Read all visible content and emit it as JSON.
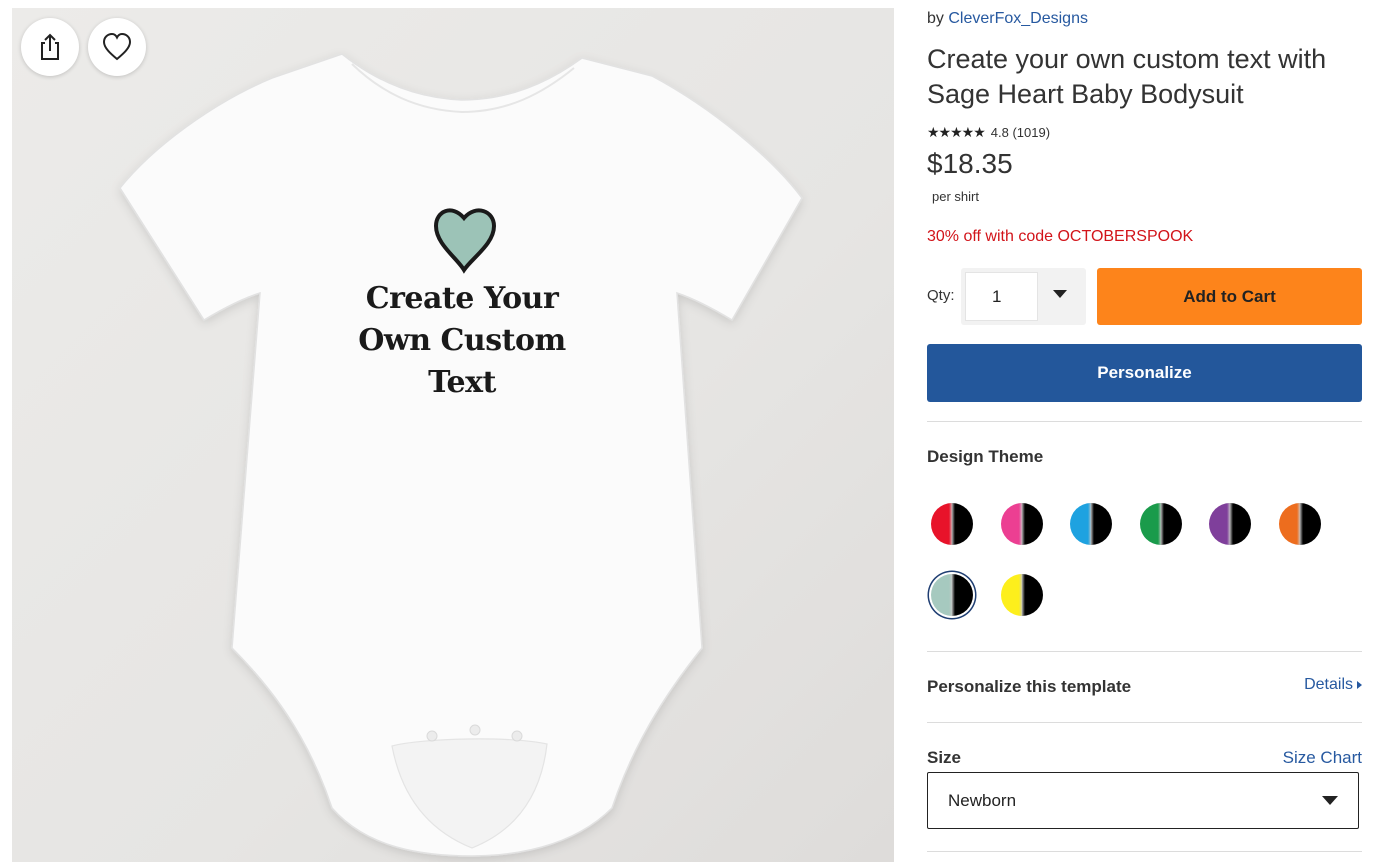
{
  "image": {
    "print_lines": [
      "Create Your",
      "Own Custom",
      "Text"
    ],
    "heart_color": "#9cc3b7",
    "share_icon": "share-icon",
    "favorite_icon": "heart-outline-icon"
  },
  "product": {
    "by_prefix": "by",
    "designer": "CleverFox_Designs",
    "title": "Create your own custom text with Sage Heart Baby Bodysuit",
    "stars": "★★★★★",
    "rating": "4.8",
    "review_count": "(1019)",
    "price": "$18.35",
    "price_unit": "per shirt",
    "promo": "30% off with code OCTOBERSPOOK"
  },
  "purchase": {
    "qty_label": "Qty:",
    "qty_value": "1",
    "add_to_cart": "Add to Cart",
    "personalize": "Personalize"
  },
  "design_theme": {
    "label": "Design Theme",
    "swatches": [
      {
        "name": "red",
        "color": "#e8132a",
        "selected": false
      },
      {
        "name": "pink",
        "color": "#ec3f92",
        "selected": false
      },
      {
        "name": "blue",
        "color": "#1ea2e0",
        "selected": false
      },
      {
        "name": "green",
        "color": "#1a9b4b",
        "selected": false
      },
      {
        "name": "purple",
        "color": "#7f3f9b",
        "selected": false
      },
      {
        "name": "orange",
        "color": "#ed6d1e",
        "selected": false
      },
      {
        "name": "sage",
        "color": "#a6c9bf",
        "selected": true
      },
      {
        "name": "yellow",
        "color": "#fdef1c",
        "selected": false
      }
    ]
  },
  "template": {
    "label": "Personalize this template",
    "details_link": "Details"
  },
  "size": {
    "label": "Size",
    "chart_link": "Size Chart",
    "selected": "Newborn"
  },
  "colors": {
    "add_to_cart": "#fd841b",
    "personalize": "#23579b",
    "promo": "#d2141a",
    "link": "#2759a0"
  }
}
